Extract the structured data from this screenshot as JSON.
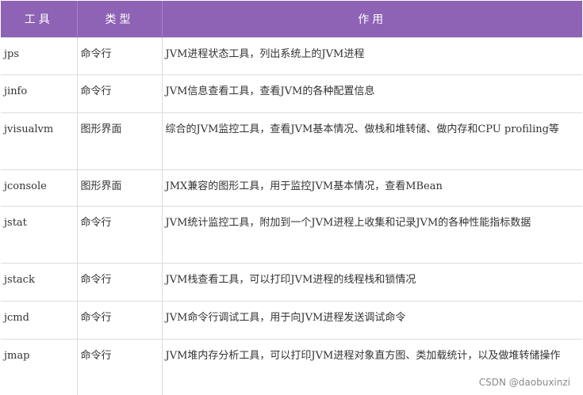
{
  "header": {
    "tool": "工具",
    "type": "类型",
    "purpose": "作用"
  },
  "rows": [
    {
      "tool": "jps",
      "type": "命令行",
      "purpose": "JVM进程状态工具，列出系统上的JVM进程"
    },
    {
      "tool": "jinfo",
      "type": "命令行",
      "purpose": "JVM信息查看工具，查看JVM的各种配置信息"
    },
    {
      "tool": "jvisualvm",
      "type": "图形界面",
      "purpose": "综合的JVM监控工具，查看JVM基本情况、做栈和堆转储、做内存和CPU profiling等"
    },
    {
      "tool": "jconsole",
      "type": "图形界面",
      "purpose": "JMX兼容的图形工具，用于监控JVM基本情况，查看MBean"
    },
    {
      "tool": "jstat",
      "type": "命令行",
      "purpose": "JVM统计监控工具，附加到一个JVM进程上收集和记录JVM的各种性能指标数据"
    },
    {
      "tool": "jstack",
      "type": "命令行",
      "purpose": "JVM栈查看工具，可以打印JVM进程的线程栈和锁情况"
    },
    {
      "tool": "jcmd",
      "type": "命令行",
      "purpose": "JVM命令行调试工具，用于向JVM进程发送调试命令"
    },
    {
      "tool": "jmap",
      "type": "命令行",
      "purpose": "JVM堆内存分析工具，可以打印JVM进程对象直方图、类加载统计，以及做堆转储操作"
    }
  ],
  "watermark": "CSDN @daobuxinzi",
  "colors": {
    "header_bg": "#8e62b4",
    "header_text": "#ffffff",
    "grid": "#dcdcdc"
  }
}
